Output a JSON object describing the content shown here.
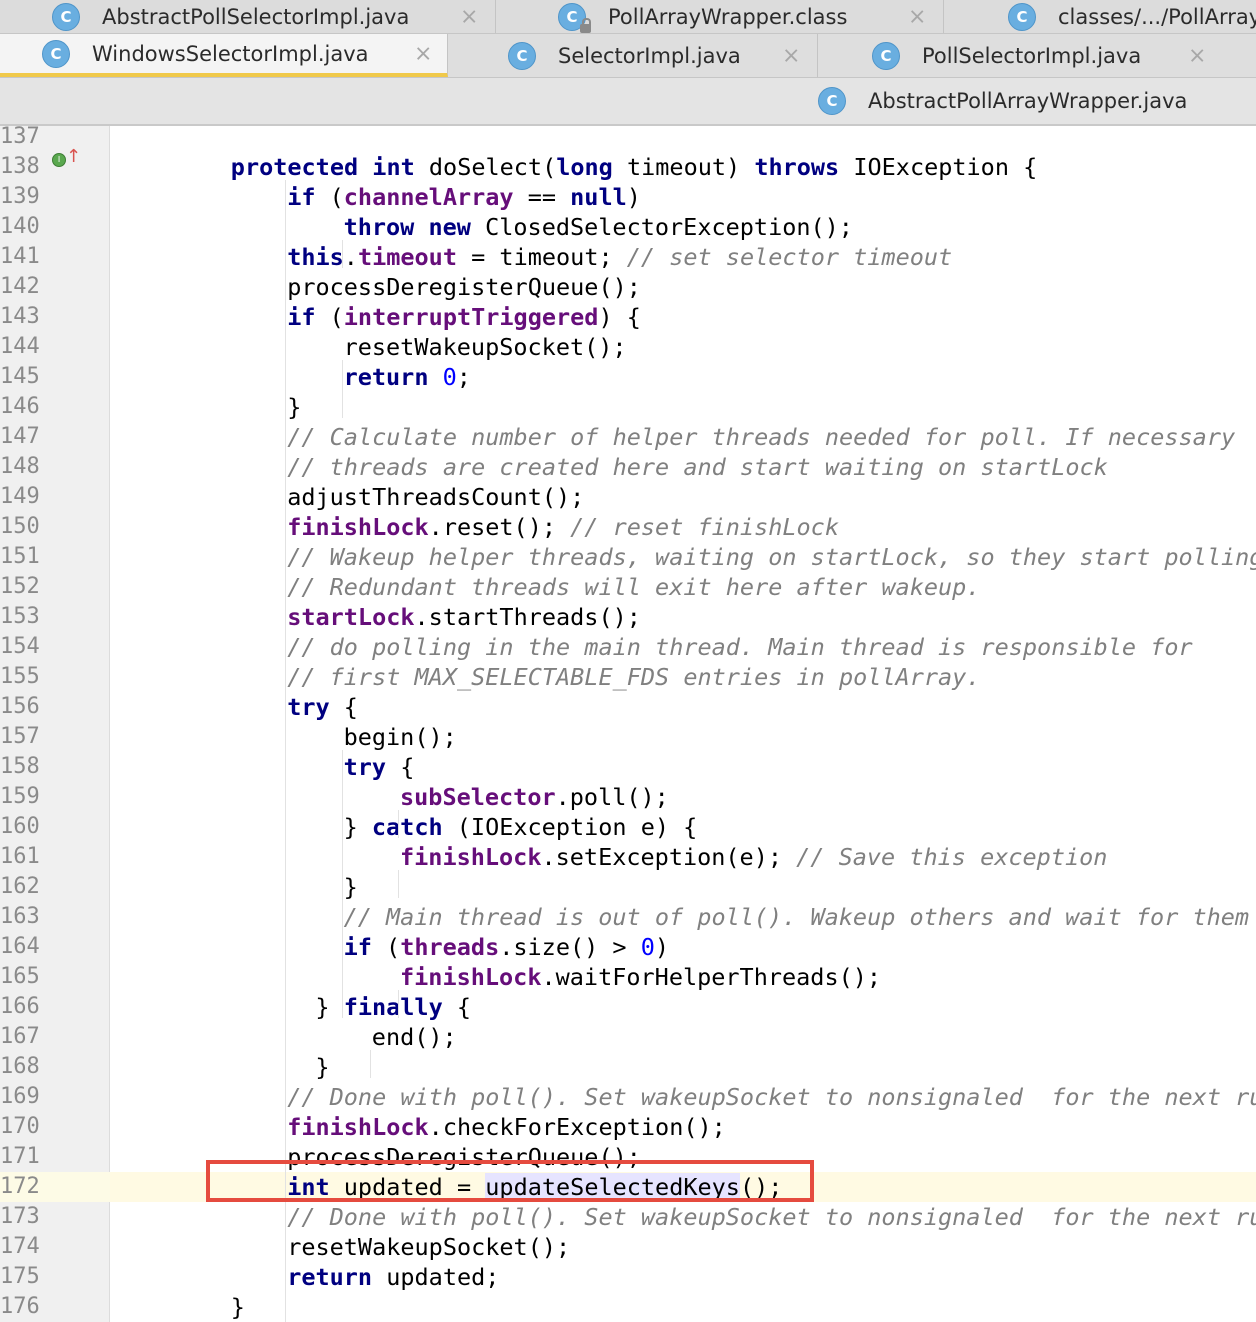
{
  "tabs": {
    "row1": [
      {
        "label": "AbstractPollSelectorImpl.java",
        "icon": "class-icon"
      },
      {
        "label": "PollArrayWrapper.class",
        "icon": "locked-class-icon"
      },
      {
        "label": "classes/.../PollArray",
        "icon": "class-icon"
      }
    ],
    "row2": [
      {
        "label": "WindowsSelectorImpl.java",
        "icon": "class-icon",
        "active": true
      },
      {
        "label": "SelectorImpl.java",
        "icon": "class-icon"
      },
      {
        "label": "PollSelectorImpl.java",
        "icon": "class-icon"
      }
    ],
    "row3": [
      {
        "label": "AbstractPollArrayWrapper.java",
        "icon": "class-icon"
      }
    ],
    "icon_letter": "C",
    "close_glyph": "×"
  },
  "editor": {
    "first_line_number": 137,
    "current_line": 172,
    "gutter_marker_line": 138,
    "gutter_marker_letter": "I",
    "gutter_marker_arrow": "↑",
    "highlight_color": "#e54b3f",
    "lines": [
      {
        "n": "137",
        "indent": 0,
        "tokens": []
      },
      {
        "n": "138",
        "indent": 2,
        "tokens": [
          [
            "kw",
            "protected"
          ],
          [
            "t",
            " "
          ],
          [
            "kw",
            "int"
          ],
          [
            "t",
            " doSelect("
          ],
          [
            "kw",
            "long"
          ],
          [
            "t",
            " timeout) "
          ],
          [
            "kw",
            "throws"
          ],
          [
            "t",
            " IOException {"
          ]
        ]
      },
      {
        "n": "139",
        "indent": 3,
        "tokens": [
          [
            "kw",
            "if"
          ],
          [
            "t",
            " ("
          ],
          [
            "fld",
            "channelArray"
          ],
          [
            "t",
            " == "
          ],
          [
            "kw",
            "null"
          ],
          [
            "t",
            ")"
          ]
        ]
      },
      {
        "n": "140",
        "indent": 4,
        "tokens": [
          [
            "kw",
            "throw"
          ],
          [
            "t",
            " "
          ],
          [
            "kw",
            "new"
          ],
          [
            "t",
            " ClosedSelectorException();"
          ]
        ]
      },
      {
        "n": "141",
        "indent": 3,
        "tokens": [
          [
            "kw",
            "this"
          ],
          [
            "t",
            "."
          ],
          [
            "fld",
            "timeout"
          ],
          [
            "t",
            " = timeout; "
          ],
          [
            "cmt",
            "// set selector timeout"
          ]
        ]
      },
      {
        "n": "142",
        "indent": 3,
        "tokens": [
          [
            "t",
            "processDeregisterQueue();"
          ]
        ]
      },
      {
        "n": "143",
        "indent": 3,
        "tokens": [
          [
            "kw",
            "if"
          ],
          [
            "t",
            " ("
          ],
          [
            "fld",
            "interruptTriggered"
          ],
          [
            "t",
            ") {"
          ]
        ]
      },
      {
        "n": "144",
        "indent": 4,
        "tokens": [
          [
            "t",
            "resetWakeupSocket();"
          ]
        ]
      },
      {
        "n": "145",
        "indent": 4,
        "tokens": [
          [
            "kw",
            "return"
          ],
          [
            "t",
            " "
          ],
          [
            "num",
            "0"
          ],
          [
            "t",
            ";"
          ]
        ]
      },
      {
        "n": "146",
        "indent": 3,
        "tokens": [
          [
            "t",
            "}"
          ]
        ]
      },
      {
        "n": "147",
        "indent": 3,
        "tokens": [
          [
            "cmt",
            "// Calculate number of helper threads needed for poll. If necessary"
          ]
        ]
      },
      {
        "n": "148",
        "indent": 3,
        "tokens": [
          [
            "cmt",
            "// threads are created here and start waiting on startLock"
          ]
        ]
      },
      {
        "n": "149",
        "indent": 3,
        "tokens": [
          [
            "t",
            "adjustThreadsCount();"
          ]
        ]
      },
      {
        "n": "150",
        "indent": 3,
        "tokens": [
          [
            "fld",
            "finishLock"
          ],
          [
            "t",
            ".reset(); "
          ],
          [
            "cmt",
            "// reset finishLock"
          ]
        ]
      },
      {
        "n": "151",
        "indent": 3,
        "tokens": [
          [
            "cmt",
            "// Wakeup helper threads, waiting on startLock, so they start polling."
          ]
        ]
      },
      {
        "n": "152",
        "indent": 3,
        "tokens": [
          [
            "cmt",
            "// Redundant threads will exit here after wakeup."
          ]
        ]
      },
      {
        "n": "153",
        "indent": 3,
        "tokens": [
          [
            "fld",
            "startLock"
          ],
          [
            "t",
            ".startThreads();"
          ]
        ]
      },
      {
        "n": "154",
        "indent": 3,
        "tokens": [
          [
            "cmt",
            "// do polling in the main thread. Main thread is responsible for"
          ]
        ]
      },
      {
        "n": "155",
        "indent": 3,
        "tokens": [
          [
            "cmt",
            "// first MAX_SELECTABLE_FDS entries in pollArray."
          ]
        ]
      },
      {
        "n": "156",
        "indent": 3,
        "tokens": [
          [
            "kw",
            "try"
          ],
          [
            "t",
            " {"
          ]
        ]
      },
      {
        "n": "157",
        "indent": 4,
        "tokens": [
          [
            "t",
            "begin();"
          ]
        ]
      },
      {
        "n": "158",
        "indent": 4,
        "tokens": [
          [
            "kw",
            "try"
          ],
          [
            "t",
            " {"
          ]
        ]
      },
      {
        "n": "159",
        "indent": 5,
        "tokens": [
          [
            "fld",
            "subSelector"
          ],
          [
            "t",
            ".poll();"
          ]
        ]
      },
      {
        "n": "160",
        "indent": 4,
        "tokens": [
          [
            "t",
            "} "
          ],
          [
            "kw",
            "catch"
          ],
          [
            "t",
            " (IOException e) {"
          ]
        ]
      },
      {
        "n": "161",
        "indent": 5,
        "tokens": [
          [
            "fld",
            "finishLock"
          ],
          [
            "t",
            ".setException(e); "
          ],
          [
            "cmt",
            "// Save this exception"
          ]
        ]
      },
      {
        "n": "162",
        "indent": 4,
        "tokens": [
          [
            "t",
            "}"
          ]
        ]
      },
      {
        "n": "163",
        "indent": 4,
        "tokens": [
          [
            "cmt",
            "// Main thread is out of poll(). Wakeup others and wait for them"
          ]
        ]
      },
      {
        "n": "164",
        "indent": 4,
        "tokens": [
          [
            "kw",
            "if"
          ],
          [
            "t",
            " ("
          ],
          [
            "fld",
            "threads"
          ],
          [
            "t",
            ".size() > "
          ],
          [
            "num",
            "0"
          ],
          [
            "t",
            ")"
          ]
        ]
      },
      {
        "n": "165",
        "indent": 5,
        "tokens": [
          [
            "fld",
            "finishLock"
          ],
          [
            "t",
            ".waitForHelperThreads();"
          ]
        ]
      },
      {
        "n": "166",
        "indent": 3.5,
        "tokens": [
          [
            "t",
            "} "
          ],
          [
            "kw",
            "finally"
          ],
          [
            "t",
            " {"
          ]
        ]
      },
      {
        "n": "167",
        "indent": 4.5,
        "tokens": [
          [
            "t",
            "end();"
          ]
        ]
      },
      {
        "n": "168",
        "indent": 3.5,
        "tokens": [
          [
            "t",
            "}"
          ]
        ]
      },
      {
        "n": "169",
        "indent": 3,
        "tokens": [
          [
            "cmt",
            "// Done with poll(). Set wakeupSocket to nonsignaled  for the next run."
          ]
        ]
      },
      {
        "n": "170",
        "indent": 3,
        "tokens": [
          [
            "fld",
            "finishLock"
          ],
          [
            "t",
            ".checkForException();"
          ]
        ]
      },
      {
        "n": "171",
        "indent": 3,
        "tokens": [
          [
            "t",
            "processDeregisterQueue();"
          ]
        ]
      },
      {
        "n": "172",
        "indent": 3,
        "tokens": [
          [
            "kw",
            "int"
          ],
          [
            "t",
            " updated = "
          ],
          [
            "hl",
            "updateSelectedKeys"
          ],
          [
            "t",
            "();"
          ]
        ]
      },
      {
        "n": "173",
        "indent": 3,
        "tokens": [
          [
            "cmt",
            "// Done with poll(). Set wakeupSocket to nonsignaled  for the next run."
          ]
        ]
      },
      {
        "n": "174",
        "indent": 3,
        "tokens": [
          [
            "t",
            "resetWakeupSocket();"
          ]
        ]
      },
      {
        "n": "175",
        "indent": 3,
        "tokens": [
          [
            "kw",
            "return"
          ],
          [
            "t",
            " updated;"
          ]
        ]
      },
      {
        "n": "176",
        "indent": 2,
        "tokens": [
          [
            "t",
            "}"
          ]
        ]
      }
    ]
  }
}
